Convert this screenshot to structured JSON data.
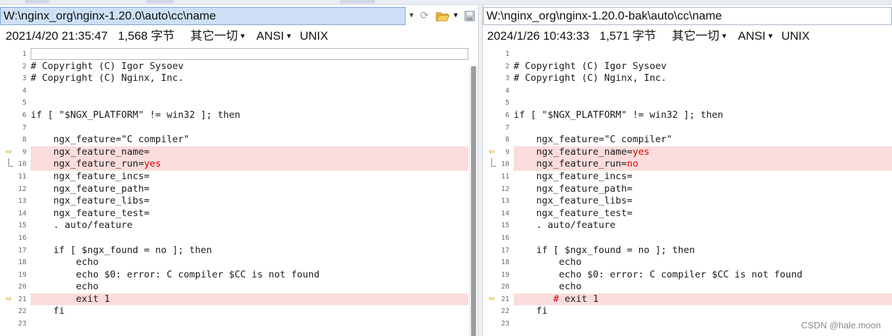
{
  "left": {
    "path": "W:\\nginx_org\\nginx-1.20.0\\auto\\cc\\name",
    "date": "2021/4/20 21:35:47",
    "size": "1,568 字节",
    "filter": "其它一切",
    "encoding": "ANSI",
    "line_ending": "UNIX",
    "lines": [
      {
        "n": "1",
        "text": "",
        "diff": false,
        "marker": "",
        "current": true
      },
      {
        "n": "2",
        "text": "# Copyright (C) Igor Sysoev",
        "diff": false,
        "marker": ""
      },
      {
        "n": "3",
        "text": "# Copyright (C) Nginx, Inc.",
        "diff": false,
        "marker": ""
      },
      {
        "n": "4",
        "text": "",
        "diff": false,
        "marker": ""
      },
      {
        "n": "5",
        "text": "",
        "diff": false,
        "marker": ""
      },
      {
        "n": "6",
        "text": "if [ \"$NGX_PLATFORM\" != win32 ]; then",
        "diff": false,
        "marker": ""
      },
      {
        "n": "7",
        "text": "",
        "diff": false,
        "marker": ""
      },
      {
        "n": "8",
        "text": "    ngx_feature=\"C compiler\"",
        "diff": false,
        "marker": ""
      },
      {
        "n": "9",
        "text": "    ngx_feature_name=",
        "diff": true,
        "marker": "arrow"
      },
      {
        "n": "10",
        "text": "    ngx_feature_run=",
        "hl": "yes",
        "diff": true,
        "marker": "bracket"
      },
      {
        "n": "11",
        "text": "    ngx_feature_incs=",
        "diff": false,
        "marker": ""
      },
      {
        "n": "12",
        "text": "    ngx_feature_path=",
        "diff": false,
        "marker": ""
      },
      {
        "n": "13",
        "text": "    ngx_feature_libs=",
        "diff": false,
        "marker": ""
      },
      {
        "n": "14",
        "text": "    ngx_feature_test=",
        "diff": false,
        "marker": ""
      },
      {
        "n": "15",
        "text": "    . auto/feature",
        "diff": false,
        "marker": ""
      },
      {
        "n": "16",
        "text": "",
        "diff": false,
        "marker": ""
      },
      {
        "n": "17",
        "text": "    if [ $ngx_found = no ]; then",
        "diff": false,
        "marker": ""
      },
      {
        "n": "18",
        "text": "        echo",
        "diff": false,
        "marker": ""
      },
      {
        "n": "19",
        "text": "        echo $0: error: C compiler $CC is not found",
        "diff": false,
        "marker": ""
      },
      {
        "n": "20",
        "text": "        echo",
        "diff": false,
        "marker": ""
      },
      {
        "n": "21",
        "text": "        exit 1",
        "diff": true,
        "marker": "arrow"
      },
      {
        "n": "22",
        "text": "    fi",
        "diff": false,
        "marker": ""
      },
      {
        "n": "23",
        "text": "",
        "diff": false,
        "marker": ""
      }
    ]
  },
  "right": {
    "path": "W:\\nginx_org\\nginx-1.20.0-bak\\auto\\cc\\name",
    "date": "2024/1/26 10:43:33",
    "size": "1,571 字节",
    "filter": "其它一切",
    "encoding": "ANSI",
    "line_ending": "UNIX",
    "lines": [
      {
        "n": "1",
        "text": "",
        "diff": false,
        "marker": ""
      },
      {
        "n": "2",
        "text": "# Copyright (C) Igor Sysoev",
        "diff": false,
        "marker": ""
      },
      {
        "n": "3",
        "text": "# Copyright (C) Nginx, Inc.",
        "diff": false,
        "marker": ""
      },
      {
        "n": "4",
        "text": "",
        "diff": false,
        "marker": ""
      },
      {
        "n": "5",
        "text": "",
        "diff": false,
        "marker": ""
      },
      {
        "n": "6",
        "text": "if [ \"$NGX_PLATFORM\" != win32 ]; then",
        "diff": false,
        "marker": ""
      },
      {
        "n": "7",
        "text": "",
        "diff": false,
        "marker": ""
      },
      {
        "n": "8",
        "text": "    ngx_feature=\"C compiler\"",
        "diff": false,
        "marker": ""
      },
      {
        "n": "9",
        "text": "    ngx_feature_name=",
        "hl": "yes",
        "diff": true,
        "marker": "arrow"
      },
      {
        "n": "10",
        "text": "    ngx_feature_run=",
        "hl": "no",
        "diff": true,
        "marker": "bracket"
      },
      {
        "n": "11",
        "text": "    ngx_feature_incs=",
        "diff": false,
        "marker": ""
      },
      {
        "n": "12",
        "text": "    ngx_feature_path=",
        "diff": false,
        "marker": ""
      },
      {
        "n": "13",
        "text": "    ngx_feature_libs=",
        "diff": false,
        "marker": ""
      },
      {
        "n": "14",
        "text": "    ngx_feature_test=",
        "diff": false,
        "marker": ""
      },
      {
        "n": "15",
        "text": "    . auto/feature",
        "diff": false,
        "marker": ""
      },
      {
        "n": "16",
        "text": "",
        "diff": false,
        "marker": ""
      },
      {
        "n": "17",
        "text": "    if [ $ngx_found = no ]; then",
        "diff": false,
        "marker": ""
      },
      {
        "n": "18",
        "text": "        echo",
        "diff": false,
        "marker": ""
      },
      {
        "n": "19",
        "text": "        echo $0: error: C compiler $CC is not found",
        "diff": false,
        "marker": ""
      },
      {
        "n": "20",
        "text": "        echo",
        "diff": false,
        "marker": ""
      },
      {
        "n": "21",
        "text": "       ",
        "hl": "#",
        "after": " exit 1",
        "diff": true,
        "marker": "arrow"
      },
      {
        "n": "22",
        "text": "    fi",
        "diff": false,
        "marker": ""
      },
      {
        "n": "23",
        "text": "",
        "diff": false,
        "marker": ""
      }
    ]
  },
  "toolbar": {
    "refresh_icon": "refresh-icon",
    "open_folder_icon": "folder-open-icon",
    "save_icon": "save-icon"
  },
  "colors": {
    "diff_bg": "#fbdcdc",
    "diff_text": "#e00000",
    "marker": "#c9a000",
    "active_path_bg": "#cde0f7"
  },
  "watermark": "CSDN @hale.moon"
}
